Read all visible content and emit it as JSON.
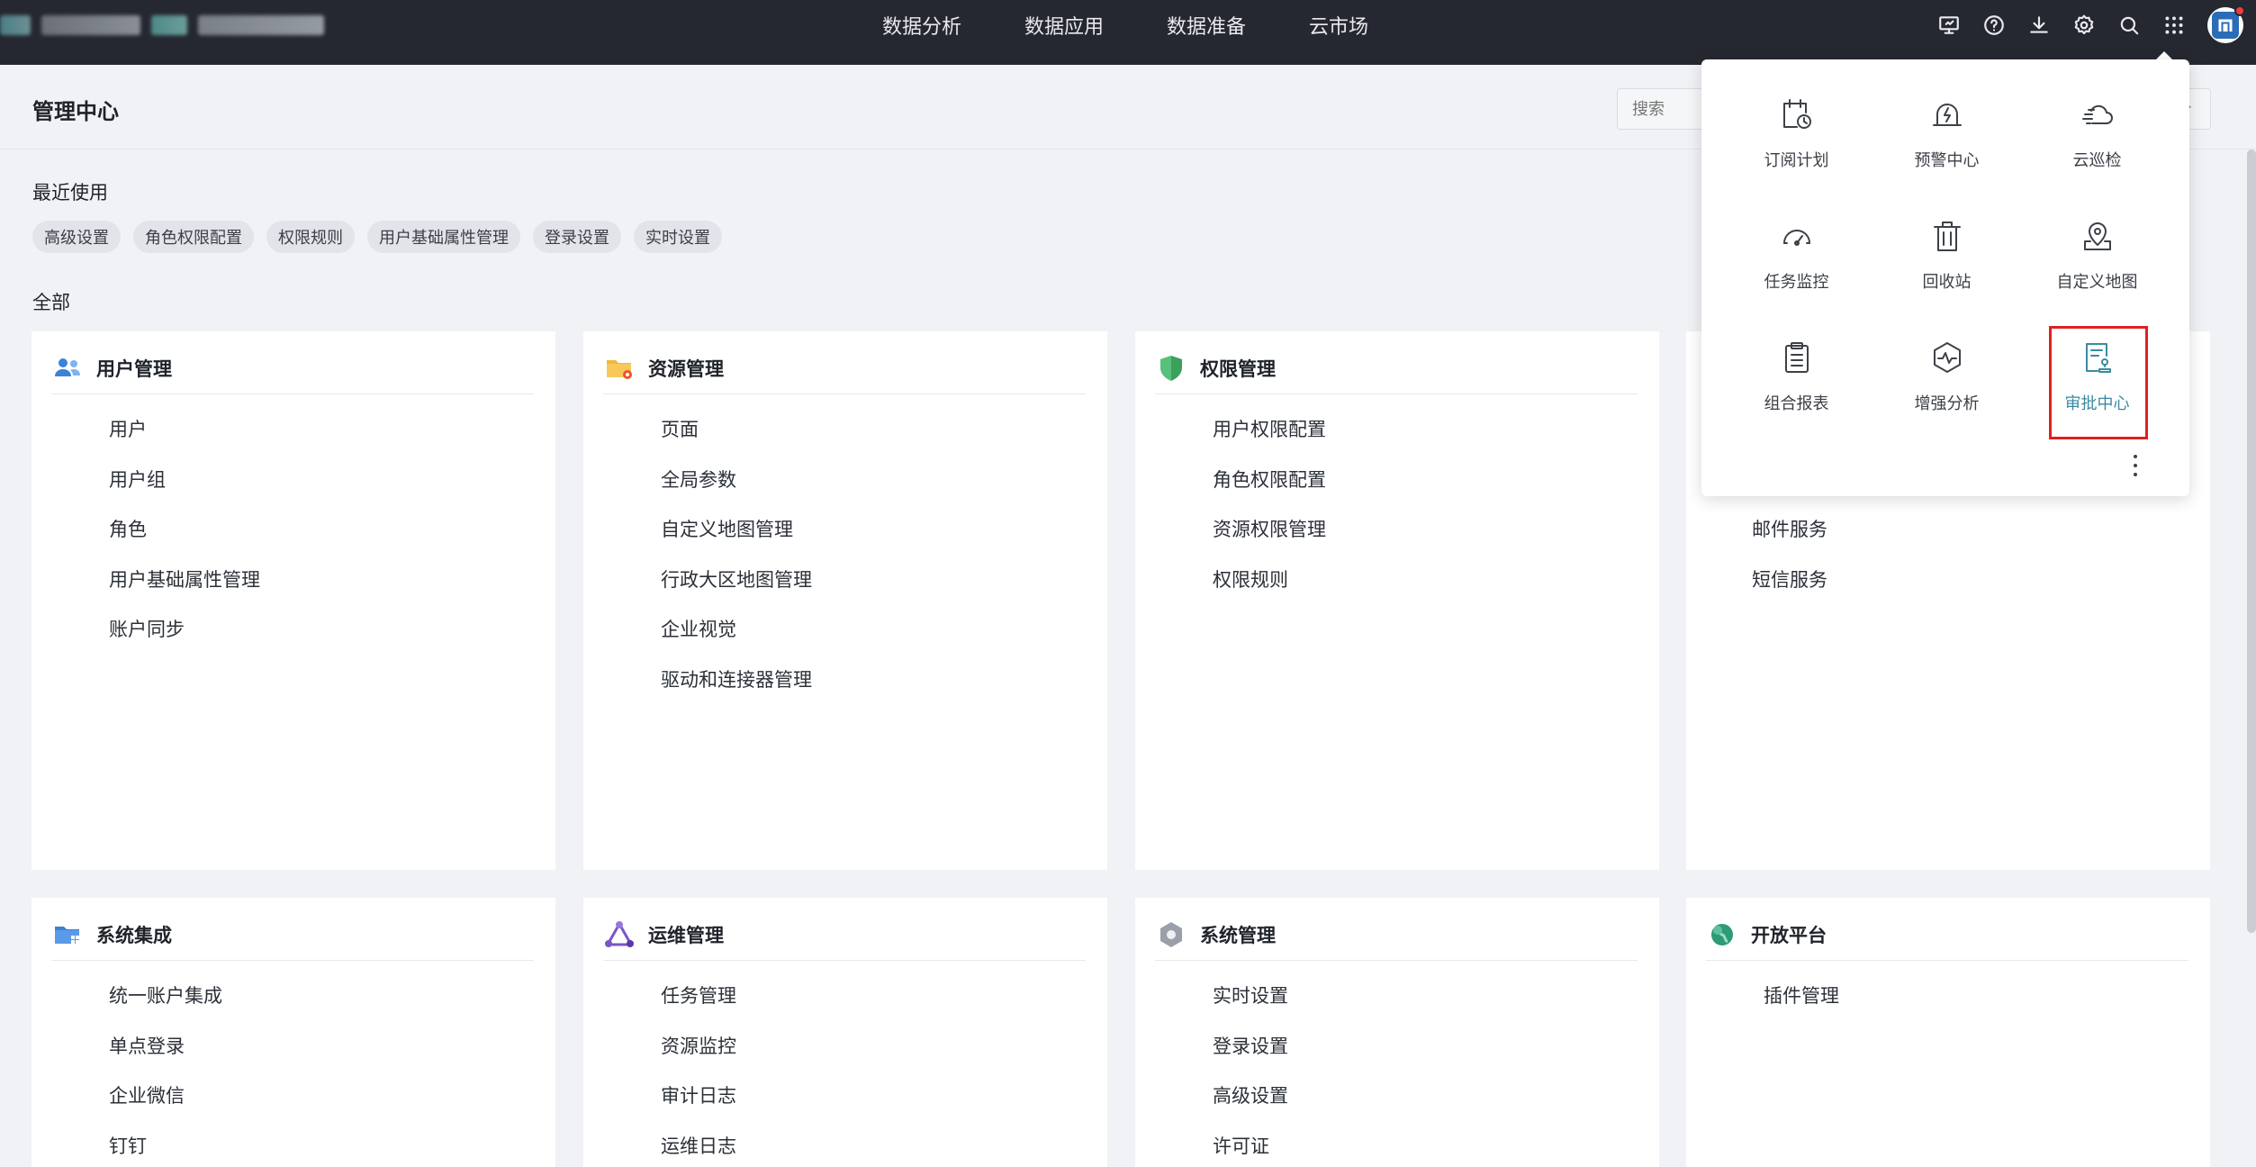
{
  "topnav": [
    "数据分析",
    "数据应用",
    "数据准备",
    "云市场"
  ],
  "header": {
    "title": "管理中心",
    "search_placeholder": "搜索"
  },
  "recent": {
    "title": "最近使用",
    "chips": [
      "高级设置",
      "角色权限配置",
      "权限规则",
      "用户基础属性管理",
      "登录设置",
      "实时设置"
    ]
  },
  "all_title": "全部",
  "cards": [
    {
      "title": "用户管理",
      "icon": "users-icon",
      "items": [
        "用户",
        "用户组",
        "角色",
        "用户基础属性管理",
        "账户同步"
      ]
    },
    {
      "title": "资源管理",
      "icon": "folder-gear-icon",
      "items": [
        "页面",
        "全局参数",
        "自定义地图管理",
        "行政大区地图管理",
        "企业视觉",
        "驱动和连接器管理"
      ]
    },
    {
      "title": "权限管理",
      "icon": "shield-icon",
      "items": [
        "用户权限配置",
        "角色权限配置",
        "资源权限管理",
        "权限规则"
      ]
    },
    {
      "title": "",
      "icon": "",
      "items": [
        "",
        "",
        "邮件服务",
        "短信服务"
      ]
    },
    {
      "title": "系统集成",
      "icon": "folder-grid-icon",
      "items": [
        "统一账户集成",
        "单点登录",
        "企业微信",
        "钉钉"
      ]
    },
    {
      "title": "运维管理",
      "icon": "triangle-nodes-icon",
      "items": [
        "任务管理",
        "资源监控",
        "审计日志",
        "运维日志"
      ]
    },
    {
      "title": "系统管理",
      "icon": "hexagon-icon",
      "items": [
        "实时设置",
        "登录设置",
        "高级设置",
        "许可证"
      ]
    },
    {
      "title": "开放平台",
      "icon": "globe-icon",
      "items": [
        "插件管理"
      ]
    }
  ],
  "apps_panel": {
    "apps": [
      {
        "label": "订阅计划",
        "icon": "calendar-clock-icon"
      },
      {
        "label": "预警中心",
        "icon": "alarm-bell-icon"
      },
      {
        "label": "云巡检",
        "icon": "cloud-icon"
      },
      {
        "label": "任务监控",
        "icon": "gauge-icon"
      },
      {
        "label": "回收站",
        "icon": "trash-icon"
      },
      {
        "label": "自定义地图",
        "icon": "map-pin-icon"
      },
      {
        "label": "组合报表",
        "icon": "clipboard-icon"
      },
      {
        "label": "增强分析",
        "icon": "hexagon-pulse-icon"
      },
      {
        "label": "审批中心",
        "icon": "approval-doc-icon"
      }
    ],
    "active": "审批中心"
  }
}
